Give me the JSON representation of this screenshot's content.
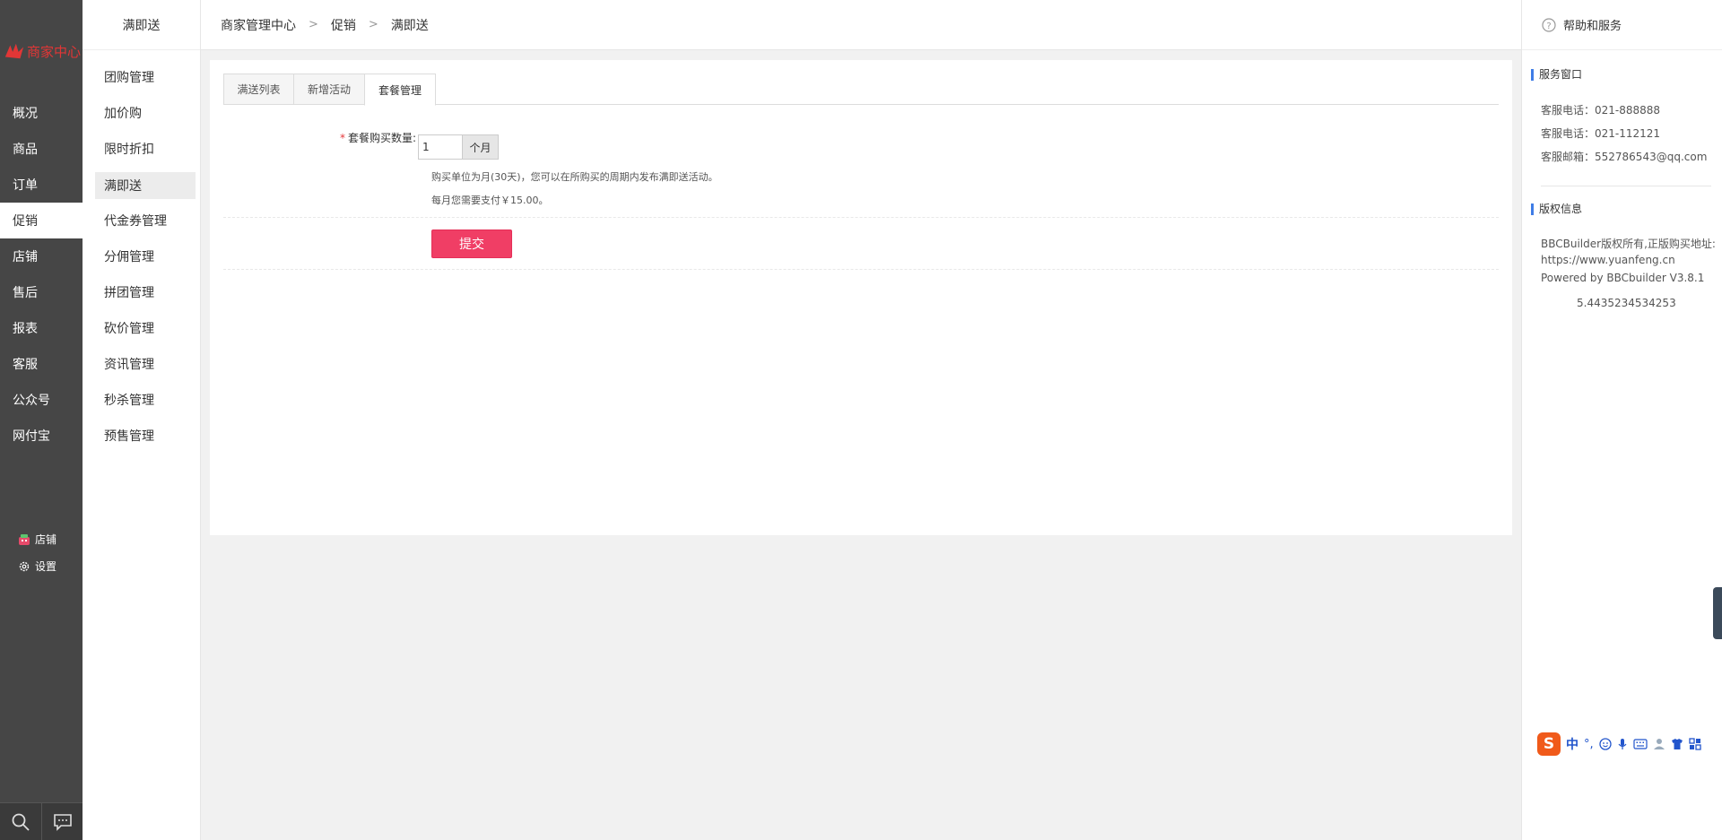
{
  "sidebar": {
    "logo_text": "商家中心",
    "items": [
      {
        "label": "概况",
        "active": false
      },
      {
        "label": "商品",
        "active": false
      },
      {
        "label": "订单",
        "active": false
      },
      {
        "label": "促销",
        "active": true
      },
      {
        "label": "店铺",
        "active": false
      },
      {
        "label": "售后",
        "active": false
      },
      {
        "label": "报表",
        "active": false
      },
      {
        "label": "客服",
        "active": false
      },
      {
        "label": "公众号",
        "active": false
      },
      {
        "label": "网付宝",
        "active": false
      }
    ],
    "bottom": [
      {
        "label": "店铺",
        "icon": "shop-icon"
      },
      {
        "label": "设置",
        "icon": "gear-icon"
      }
    ],
    "tools": [
      "search-icon",
      "message-icon"
    ]
  },
  "submenu": {
    "title": "满即送",
    "items": [
      {
        "label": "团购管理",
        "active": false
      },
      {
        "label": "加价购",
        "active": false
      },
      {
        "label": "限时折扣",
        "active": false
      },
      {
        "label": "满即送",
        "active": true
      },
      {
        "label": "代金券管理",
        "active": false
      },
      {
        "label": "分佣管理",
        "active": false
      },
      {
        "label": "拼团管理",
        "active": false
      },
      {
        "label": "砍价管理",
        "active": false
      },
      {
        "label": "资讯管理",
        "active": false
      },
      {
        "label": "秒杀管理",
        "active": false
      },
      {
        "label": "预售管理",
        "active": false
      }
    ]
  },
  "breadcrumb": [
    "商家管理中心",
    "促销",
    "满即送"
  ],
  "tabs": [
    {
      "label": "满送列表",
      "active": false
    },
    {
      "label": "新增活动",
      "active": false
    },
    {
      "label": "套餐管理",
      "active": true
    }
  ],
  "form": {
    "required_mark": "*",
    "qty_label": "套餐购买数量:",
    "qty_value": "1",
    "qty_unit": "个月",
    "hint1": "购买单位为月(30天)，您可以在所购买的周期内发布满即送活动。",
    "hint2": "每月您需要支付￥15.00。",
    "submit_label": "提交"
  },
  "help": {
    "title": "帮助和服务",
    "service_title": "服务窗口",
    "service_lines": [
      "客服电话：021-888888",
      "客服电话：021-112121",
      "客服邮箱：552786543@qq.com"
    ],
    "copyright_title": "版权信息",
    "copyright_lines": [
      "BBCBuilder版权所有,正版购买地址:",
      "https://www.yuanfeng.cn",
      "Powered by BBCbuilder V3.8.1"
    ],
    "version_number": "5.4435234534253"
  },
  "ime": {
    "logo": "S",
    "mode": "中",
    "punct": "°,"
  },
  "colors": {
    "sidebar_bg": "#464646",
    "submit_bg": "#f03e65",
    "accent_blue": "#3f7de6",
    "logo_red": "#e23636"
  }
}
